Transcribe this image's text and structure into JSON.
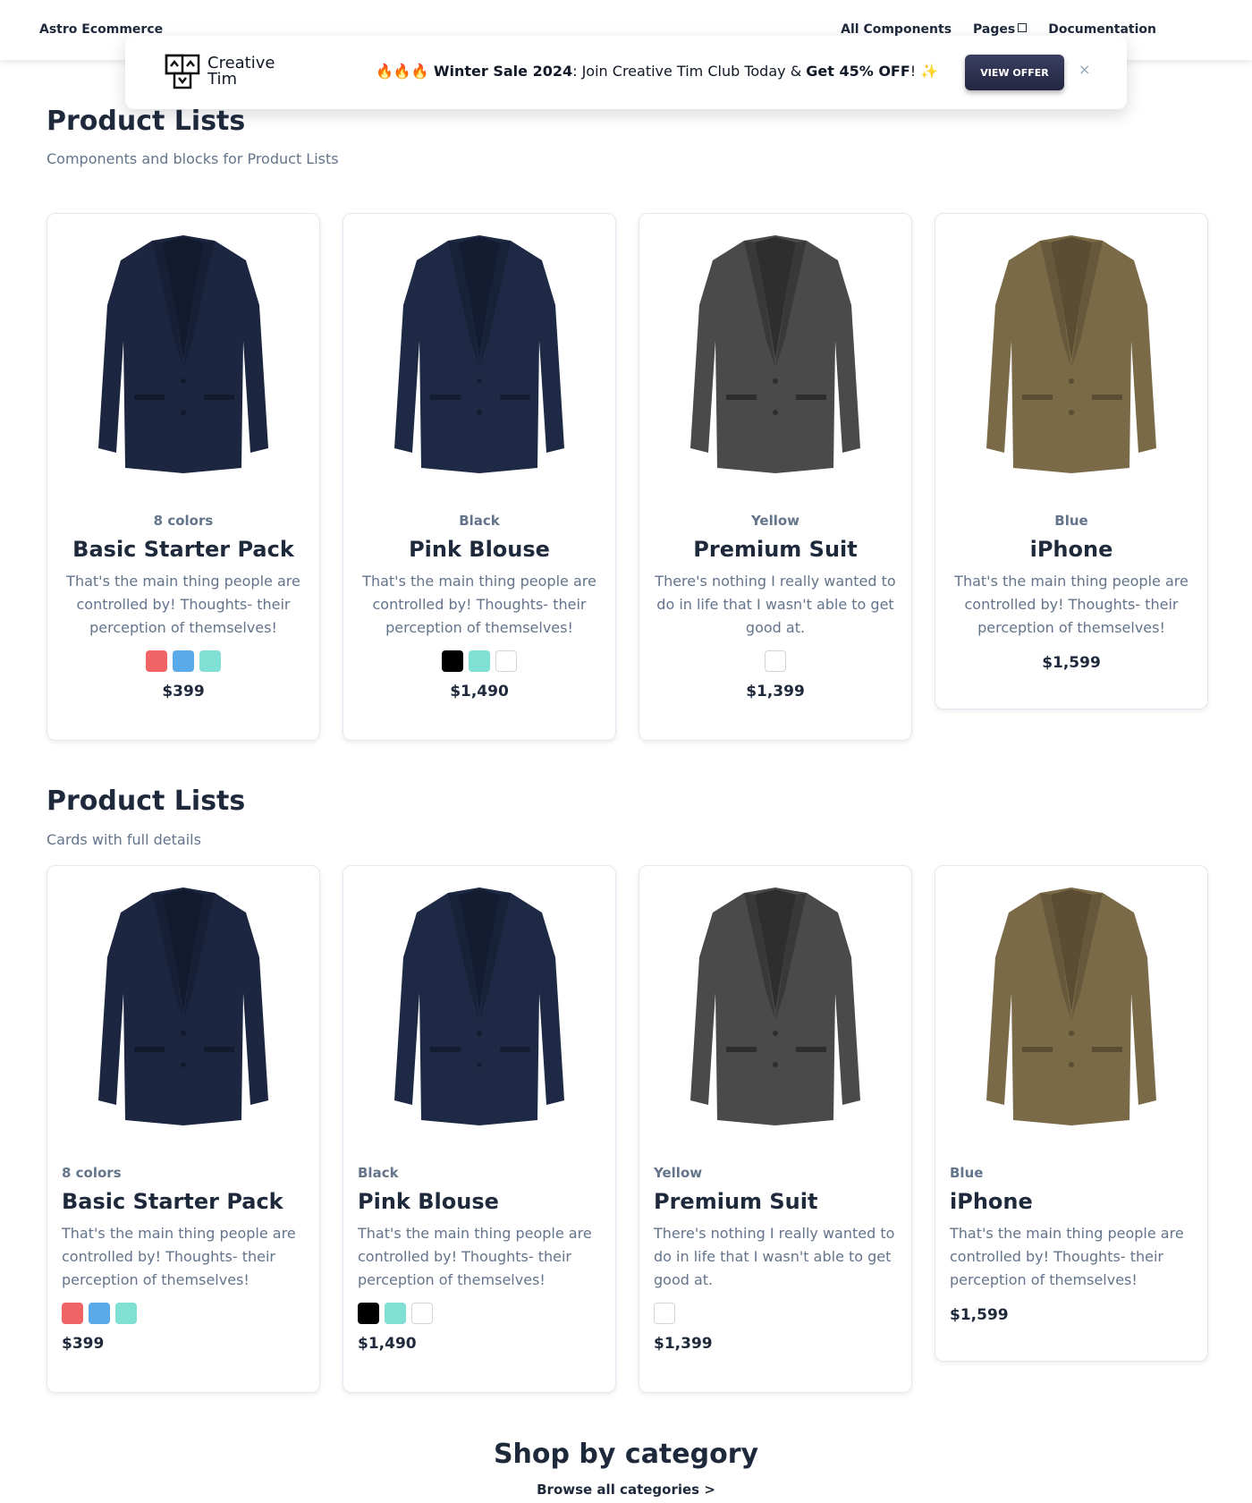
{
  "nav": {
    "brand": "Astro Ecommerce",
    "links": [
      "All Components",
      "Pages",
      "Documentation"
    ]
  },
  "banner": {
    "logo_line1": "Creative",
    "logo_line2": "Tim",
    "emoji_prefix": "🔥🔥🔥",
    "bold1": "Winter Sale 2024",
    "middle": ": Join Creative Tim Club Today & ",
    "bold2": "Get 45% OFF",
    "suffix": "! ✨",
    "button": "VIEW OFFER",
    "close": "×"
  },
  "section1": {
    "title": "Product Lists",
    "subtitle": "Components and blocks for Product Lists"
  },
  "section2": {
    "title": "Product Lists",
    "subtitle": "Cards with full details"
  },
  "products": [
    {
      "variant": "8 colors",
      "name": "Basic Starter Pack",
      "desc": "That's the main thing people are controlled by! Thoughts- their perception of themselves!",
      "price": "$399",
      "swatches": [
        "#f06466",
        "#5aa9e8",
        "#7fe0d3"
      ],
      "jacket": "#1c2640",
      "shade": "#121a2e"
    },
    {
      "variant": "Black",
      "name": "Pink Blouse",
      "desc": "That's the main thing people are controlled by! Thoughts- their perception of themselves!",
      "price": "$1,490",
      "swatches": [
        "#000000",
        "#7fe0d3",
        "#ffffff"
      ],
      "jacket": "#1e2a45",
      "shade": "#131c31"
    },
    {
      "variant": "Yellow",
      "name": "Premium Suit",
      "desc": "There's nothing I really wanted to do in life that I wasn't able to get good at.",
      "price": "$1,399",
      "swatches": [
        "#ffffff"
      ],
      "jacket": "#4a4a4a",
      "shade": "#2e2e2e"
    },
    {
      "variant": "Blue",
      "name": "iPhone",
      "desc": "That's the main thing people are controlled by! Thoughts- their perception of themselves!",
      "price": "$1,599",
      "swatches": [],
      "jacket": "#7a6a48",
      "shade": "#5a4d33"
    }
  ],
  "shop": {
    "title": "Shop by category",
    "browse": "Browse all categories >"
  }
}
